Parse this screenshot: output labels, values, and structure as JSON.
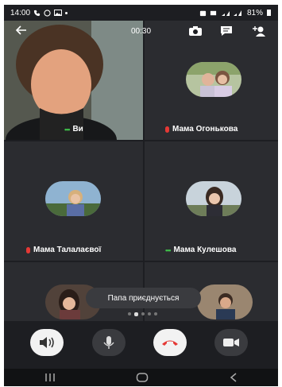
{
  "status_bar": {
    "time": "14:00",
    "battery": "81%"
  },
  "call": {
    "timer": "00:30"
  },
  "participants": [
    {
      "name": "Ви",
      "mic": "active"
    },
    {
      "name": "Мама Огонькова",
      "mic": "muted"
    },
    {
      "name": "Мама Талалаєвої",
      "mic": "muted"
    },
    {
      "name": "Мама Кулешова",
      "mic": "active"
    }
  ],
  "toast": "Папа приєднується",
  "pager": {
    "pages": 5,
    "current": 2
  },
  "colors": {
    "end_call": "#e53935",
    "active_speaker": "#3fbf4a",
    "background": "#1d1e22",
    "tile": "#2b2c30"
  },
  "icons": {
    "back": "arrow-left-icon",
    "switch_camera": "switch-camera-icon",
    "chat": "chat-icon",
    "add_person": "add-person-icon",
    "speaker": "speaker-icon",
    "mic": "mic-icon",
    "end_call": "end-call-icon",
    "video": "video-camera-icon"
  }
}
